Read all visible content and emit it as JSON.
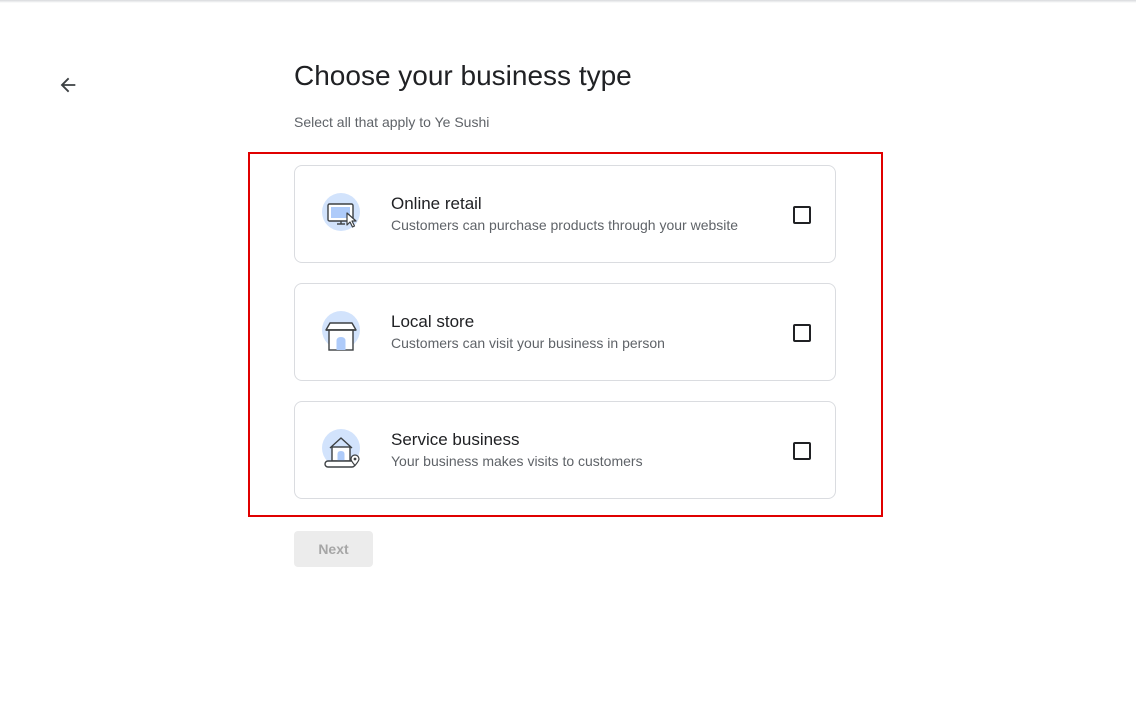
{
  "header": {
    "back_icon": "arrow-back-icon",
    "title": "Choose your business type",
    "subtitle": "Select all that apply to Ye Sushi"
  },
  "options": [
    {
      "icon": "monitor-cursor-icon",
      "title": "Online retail",
      "description": "Customers can purchase products through your website",
      "checked": false
    },
    {
      "icon": "storefront-icon",
      "title": "Local store",
      "description": "Customers can visit your business in person",
      "checked": false
    },
    {
      "icon": "house-location-icon",
      "title": "Service business",
      "description": "Your business makes visits to customers",
      "checked": false
    }
  ],
  "footer": {
    "next_label": "Next",
    "next_disabled": true
  },
  "colors": {
    "highlight_border": "#e00000",
    "card_border": "#dadce0",
    "icon_circle": "#d2e3fc",
    "icon_accent": "#aecbfa",
    "text_primary": "#202124",
    "text_secondary": "#5f6368",
    "disabled_button_bg": "#ececec",
    "disabled_button_text": "#a6a6a6"
  }
}
